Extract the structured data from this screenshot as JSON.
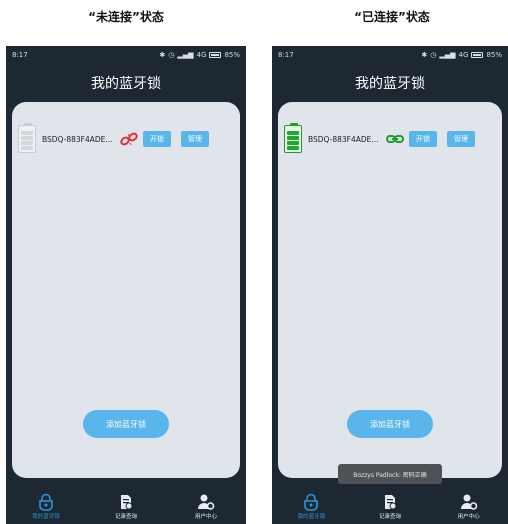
{
  "captions": {
    "left": "“未连接”状态",
    "right": "“已连接”状态"
  },
  "colors": {
    "accent": "#5ab6ea",
    "nav_active": "#2a97d6",
    "connected": "#1e9c2c",
    "disconnected_link": "#e0303a"
  },
  "phones": [
    {
      "status_time": "8:17",
      "status_battery": "85%",
      "status_network": "4G",
      "title": "我的蓝牙锁",
      "lock": {
        "name": "BSDQ-883F4ADE...",
        "state": "disconnected",
        "battery_icon": "battery-empty-icon",
        "link_icon": "broken-link-icon",
        "unlock_label": "开锁",
        "manage_label": "管理"
      },
      "add_button": "添加蓝牙锁",
      "nav": [
        {
          "label": "我的蓝牙锁",
          "icon": "lock-icon",
          "active": true
        },
        {
          "label": "记录查询",
          "icon": "records-icon",
          "active": false
        },
        {
          "label": "用户中心",
          "icon": "user-settings-icon",
          "active": false
        }
      ]
    },
    {
      "status_time": "8:17",
      "status_battery": "85%",
      "status_network": "4G",
      "title": "我的蓝牙锁",
      "lock": {
        "name": "BSDQ-883F4ADE...",
        "state": "connected",
        "battery_icon": "battery-full-icon",
        "link_icon": "link-icon",
        "unlock_label": "开锁",
        "manage_label": "管理"
      },
      "add_button": "添加蓝牙锁",
      "toast": "Bozzys Padlock: 密码正确",
      "nav": [
        {
          "label": "我的蓝牙锁",
          "icon": "lock-icon",
          "active": true
        },
        {
          "label": "记录查询",
          "icon": "records-icon",
          "active": false
        },
        {
          "label": "用户中心",
          "icon": "user-settings-icon",
          "active": false
        }
      ]
    }
  ]
}
